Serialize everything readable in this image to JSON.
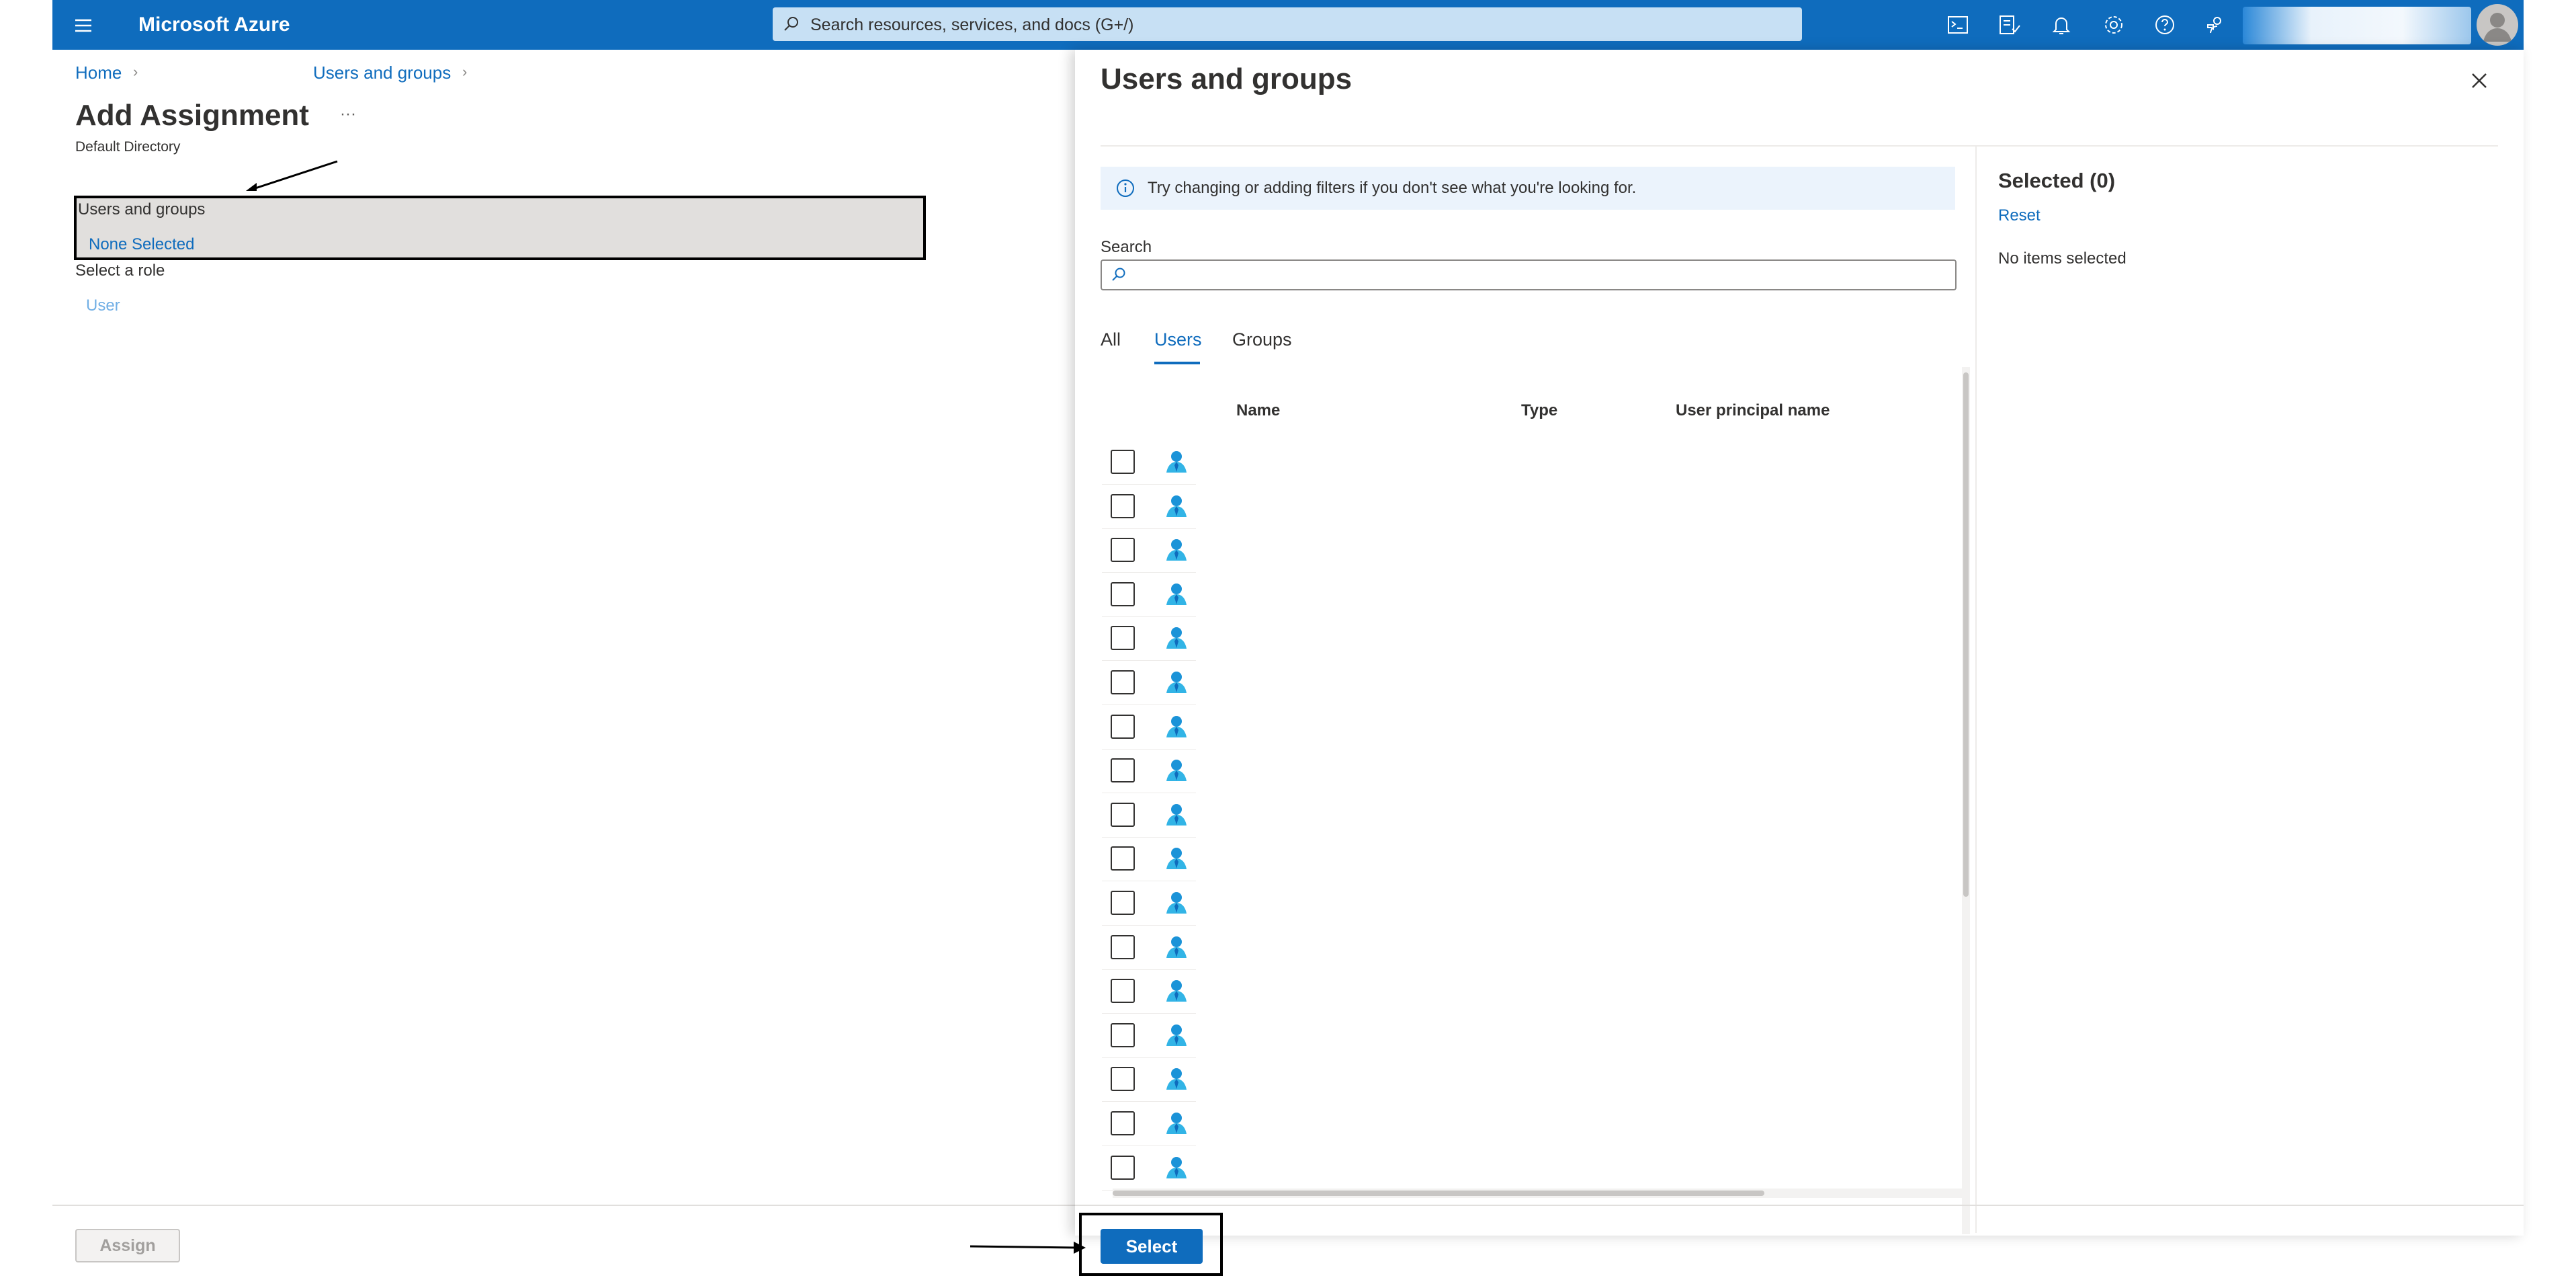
{
  "topbar": {
    "brand": "Microsoft Azure",
    "search_placeholder": "Search resources, services, and docs (G+/)",
    "icons": [
      "menu-icon",
      "cloud-shell-icon",
      "directory-filter-icon",
      "notifications-icon",
      "settings-icon",
      "help-icon",
      "feedback-icon",
      "avatar"
    ],
    "accent": "#0f6cbd"
  },
  "breadcrumb": {
    "home": "Home",
    "users_and_groups": "Users and groups"
  },
  "blade": {
    "title": "Add Assignment",
    "more": "···",
    "subtitle": "Default Directory",
    "users_groups_label": "Users and groups",
    "users_groups_value": "None Selected",
    "role_label": "Select a role",
    "role_value": "User",
    "assign_button": "Assign"
  },
  "panel": {
    "title": "Users and groups",
    "info": "Try changing or adding filters if you don't see what you're looking for.",
    "search_label": "Search",
    "search_value": "",
    "tabs": [
      "All",
      "Users",
      "Groups"
    ],
    "active_tab": "Users",
    "columns": {
      "name": "Name",
      "type": "Type",
      "upn": "User principal name"
    },
    "row_count": 17,
    "selected": {
      "title": "Selected (0)",
      "reset": "Reset",
      "empty": "No items selected"
    },
    "select_button": "Select"
  }
}
